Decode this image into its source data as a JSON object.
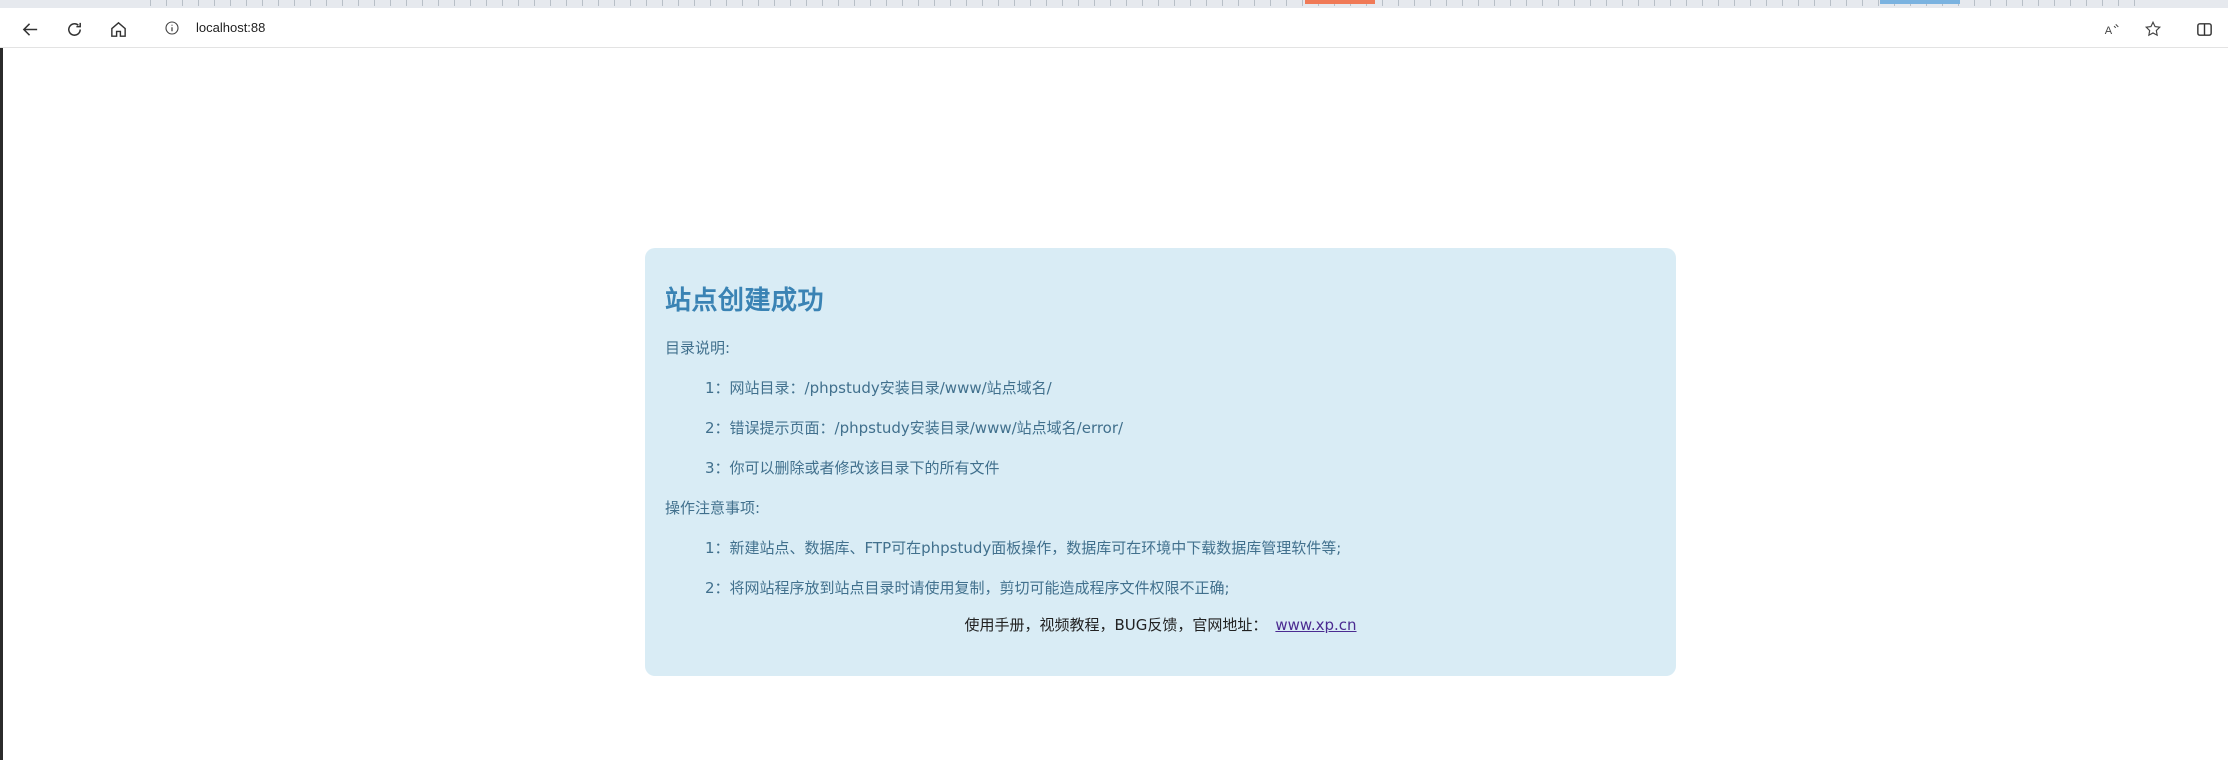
{
  "browser": {
    "address": "localhost:88",
    "icons": [
      "back-icon",
      "reload-icon",
      "home-icon",
      "info-icon",
      "read-aloud-icon",
      "favorite-star-icon",
      "split-screen-icon"
    ]
  },
  "colors": {
    "card_bg": "#d9ecf5",
    "title": "#3a83b4",
    "body_text": "#41708d",
    "link": "#4b2b91"
  },
  "page": {
    "title": "站点创建成功",
    "dir_label": "目录说明:",
    "dir_items": [
      "1：网站目录：/phpstudy安装目录/www/站点域名/",
      "2：错误提示页面：/phpstudy安装目录/www/站点域名/error/",
      "3：你可以删除或者修改该目录下的所有文件"
    ],
    "ops_label": "操作注意事项:",
    "ops_items": [
      "1：新建站点、数据库、FTP可在phpstudy面板操作，数据库可在环境中下载数据库管理软件等;",
      "2：将网站程序放到站点目录时请使用复制，剪切可能造成程序文件权限不正确;"
    ],
    "footer_text": "使用手册，视频教程，BUG反馈，官网地址：",
    "footer_link": "www.xp.cn"
  }
}
